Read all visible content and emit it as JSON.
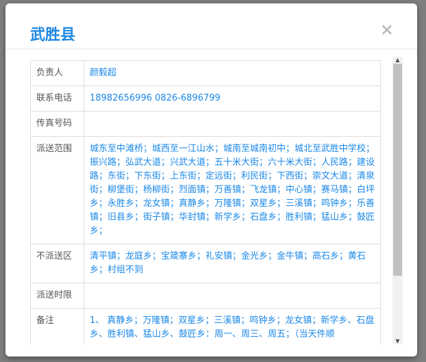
{
  "title": "武胜县",
  "close_label": "×",
  "rows": [
    {
      "label": "负责人",
      "value": "颜毅超"
    },
    {
      "label": "联系电话",
      "value": "18982656996 0826-6896799"
    },
    {
      "label": "传真号码",
      "value": ""
    },
    {
      "label": "派送范围",
      "value": "城东至中滩桥；城西至一江山水；城南至城南初中；城北至武胜中学校；振兴路；弘武大道；兴武大道；五十米大街；六十米大街；人民路；建设路；东街；下东街；上东街；定远街；利民街；下西街；崇文大道；清泉街；柳堡街；杨柳街；烈面镇；万善镇；飞龙镇；中心镇；赛马镇；白坪乡；永胜乡；龙女镇；真静乡；万隆镇；双星乡；三溪镇；鸣钟乡；乐善镇；旧县乡；街子镇；华封镇；新学乡；石盘乡；胜利镇；猛山乡；鼓匠乡；"
    },
    {
      "label": "不派送区",
      "value": "清平镇；龙庭乡；宝箴寨乡；礼安镇；金光乡；金牛镇；高石乡；黄石乡；村组不到"
    },
    {
      "label": "派送时限",
      "value": ""
    },
    {
      "label": "备注",
      "value": "1、 真静乡；万隆镇；双星乡；三溪镇；鸣钟乡；龙女镇；新学乡、石盘乡、胜利镇、猛山乡、鼓匠乡：周一、周三、周五；（当天件顺"
    }
  ]
}
